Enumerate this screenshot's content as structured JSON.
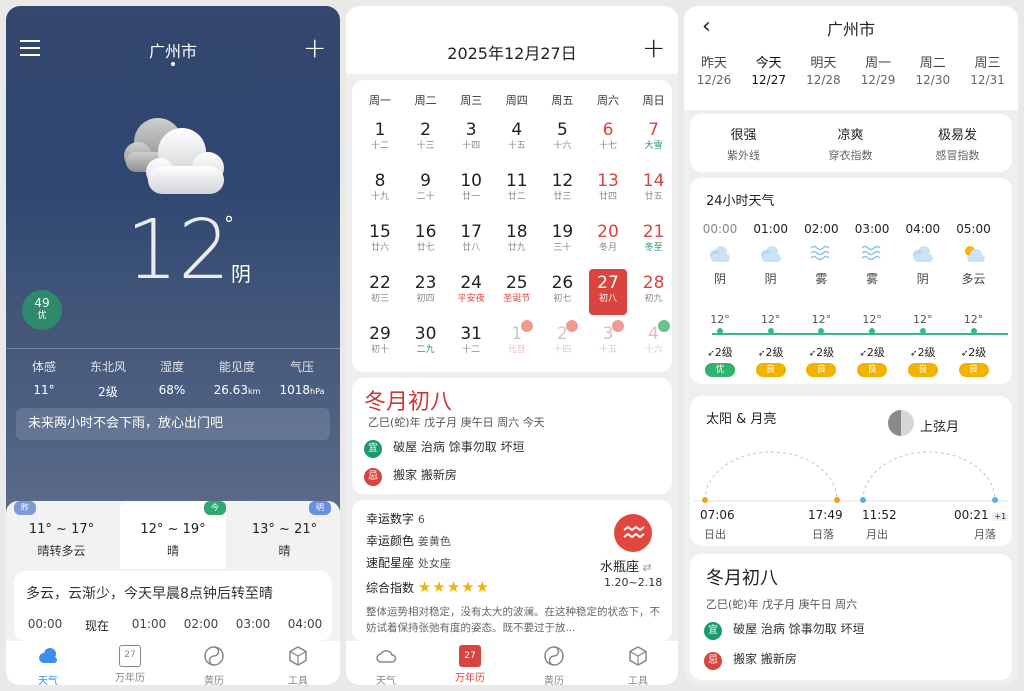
{
  "p1": {
    "city": "广州市",
    "temp": "12",
    "deg": "°",
    "cond": "阴",
    "aqi": {
      "value": "49",
      "label": "优"
    },
    "details": [
      {
        "label": "体感",
        "value": "11°",
        "unit": ""
      },
      {
        "label": "东北风",
        "value": "2级",
        "unit": ""
      },
      {
        "label": "湿度",
        "value": "68%",
        "unit": ""
      },
      {
        "label": "能见度",
        "value": "26.63",
        "unit": "km"
      },
      {
        "label": "气压",
        "value": "1018",
        "unit": "hPa"
      }
    ],
    "rain_note": "未来两小时不会下雨，放心出门吧",
    "days": [
      {
        "badge": "昨",
        "range": "11° ~ 17°",
        "cond": "晴转多云"
      },
      {
        "badge": "今",
        "range": "12° ~ 19°",
        "cond": "晴"
      },
      {
        "badge": "明",
        "range": "13° ~ 21°",
        "cond": "晴"
      }
    ],
    "forecast_text": "多云，云渐少，今天早晨8点钟后转至晴",
    "hours": [
      "00:00",
      "现在",
      "01:00",
      "02:00",
      "03:00",
      "04:00"
    ],
    "nav": [
      "天气",
      "万年历",
      "黄历",
      "工具"
    ],
    "nav_day": "27"
  },
  "p2": {
    "date_title": "2025年12月27日",
    "weekdays": [
      "周一",
      "周二",
      "周三",
      "周四",
      "周五",
      "周六",
      "周日"
    ],
    "weeks": [
      [
        [
          "1",
          "十二"
        ],
        [
          "2",
          "十三"
        ],
        [
          "3",
          "十四"
        ],
        [
          "4",
          "十五"
        ],
        [
          "5",
          "十六"
        ],
        [
          "6",
          "十七"
        ],
        [
          "7",
          "大雪"
        ]
      ],
      [
        [
          "8",
          "十九"
        ],
        [
          "9",
          "二十"
        ],
        [
          "10",
          "廿一"
        ],
        [
          "11",
          "廿二"
        ],
        [
          "12",
          "廿三"
        ],
        [
          "13",
          "廿四"
        ],
        [
          "14",
          "廿五"
        ]
      ],
      [
        [
          "15",
          "廿六"
        ],
        [
          "16",
          "廿七"
        ],
        [
          "17",
          "廿八"
        ],
        [
          "18",
          "廿九"
        ],
        [
          "19",
          "三十"
        ],
        [
          "20",
          "冬月"
        ],
        [
          "21",
          "冬至"
        ]
      ],
      [
        [
          "22",
          "初三"
        ],
        [
          "23",
          "初四"
        ],
        [
          "24",
          "平安夜"
        ],
        [
          "25",
          "圣诞节"
        ],
        [
          "26",
          "初七"
        ],
        [
          "27",
          "初八"
        ],
        [
          "28",
          "初九"
        ]
      ],
      [
        [
          "29",
          "初十"
        ],
        [
          "30",
          "二九"
        ],
        [
          "31",
          "十二"
        ],
        [
          "1",
          "元旦"
        ],
        [
          "2",
          "十四"
        ],
        [
          "3",
          "十五"
        ],
        [
          "4",
          "十六"
        ]
      ]
    ],
    "almanac": {
      "title": "冬月初八",
      "ganzhi": "乙巳(蛇)年 戊子月 庚午日 周六  今天",
      "yi_tag": "宜",
      "yi": "破屋 治病 馀事勿取 坏垣",
      "ji_tag": "忌",
      "ji": "搬家 搬新房"
    },
    "luck": {
      "num_label": "幸运数字",
      "num": "6",
      "color_label": "幸运颜色",
      "color": "姜黄色",
      "match_label": "速配星座",
      "match": "处女座",
      "score_label": "综合指数",
      "sign": "水瓶座",
      "sign_range": "1.20~2.18",
      "desc": "整体运势相对稳定，没有太大的波澜。在这种稳定的状态下，不妨试着保持张弛有度的姿态。既不要过于放..."
    },
    "nav": [
      "天气",
      "万年历",
      "黄历",
      "工具"
    ],
    "nav_day": "27"
  },
  "p3": {
    "city": "广州市",
    "days": [
      [
        "昨天",
        "12/26"
      ],
      [
        "今天",
        "12/27"
      ],
      [
        "明天",
        "12/28"
      ],
      [
        "周一",
        "12/29"
      ],
      [
        "周二",
        "12/30"
      ],
      [
        "周三",
        "12/31"
      ]
    ],
    "indices": [
      [
        "很强",
        "紫外线"
      ],
      [
        "凉爽",
        "穿衣指数"
      ],
      [
        "极易发",
        "感冒指数"
      ]
    ],
    "hourly_title": "24小时天气",
    "hourly": [
      {
        "t": "00:00",
        "c": "阴",
        "temp": "12°",
        "wind": "2级",
        "aqi": "优"
      },
      {
        "t": "01:00",
        "c": "阴",
        "temp": "12°",
        "wind": "2级",
        "aqi": "良"
      },
      {
        "t": "02:00",
        "c": "雾",
        "temp": "12°",
        "wind": "2级",
        "aqi": "良"
      },
      {
        "t": "03:00",
        "c": "雾",
        "temp": "12°",
        "wind": "2级",
        "aqi": "良"
      },
      {
        "t": "04:00",
        "c": "阴",
        "temp": "12°",
        "wind": "2级",
        "aqi": "良"
      },
      {
        "t": "05:00",
        "c": "多云",
        "temp": "12°",
        "wind": "2级",
        "aqi": "良"
      }
    ],
    "sun_title": "太阳 & 月亮",
    "moon_phase": "上弦月",
    "sunrise": "07:06",
    "sunrise_label": "日出",
    "sunset": "17:49",
    "sunset_label": "日落",
    "moonrise": "11:52",
    "moonrise_label": "月出",
    "moonset": "00:21",
    "moonset_plus": "+1",
    "moonset_label": "月落",
    "almanac": {
      "title": "冬月初八",
      "ganzhi": "乙巳(蛇)年 戊子月 庚午日 周六",
      "yi_tag": "宜",
      "yi": "破屋 治病 馀事勿取 坏垣",
      "ji_tag": "忌",
      "ji": "搬家 搬新房"
    }
  },
  "colors": {
    "red": "#d9443e",
    "green": "#1a9a6e",
    "orange": "#f0a800",
    "sky": "#6fa8dc"
  }
}
